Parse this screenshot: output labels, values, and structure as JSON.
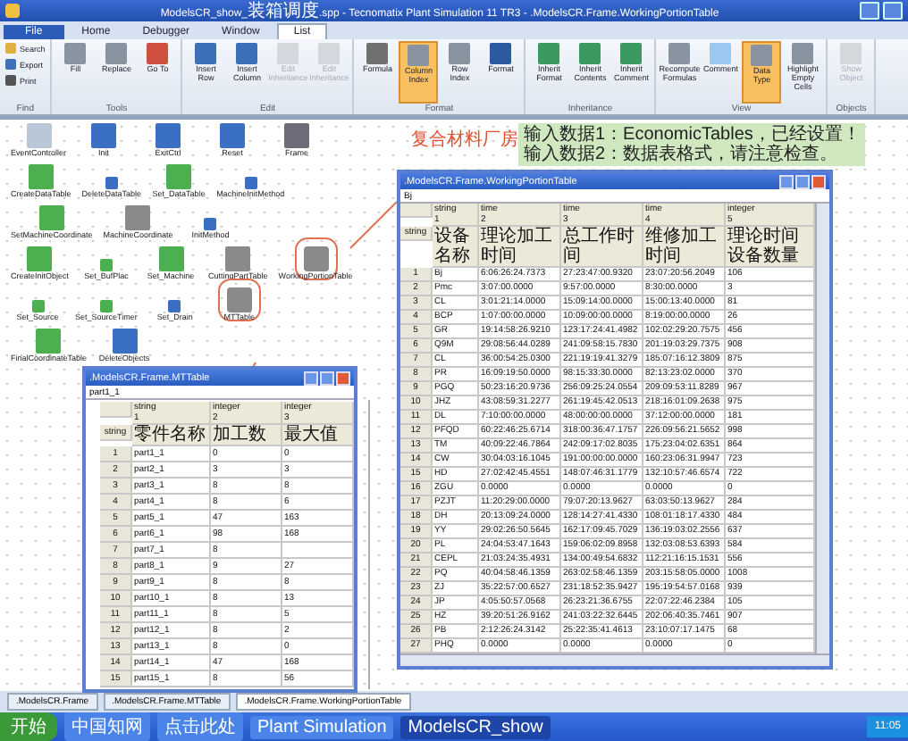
{
  "window": {
    "title_start": "ModelsCR_show_",
    "title_cjk": "装箱调度",
    "title_end": ".spp - Tecnomatix Plant Simulation 11 TR3 - .ModelsCR.Frame.WorkingPortionTable"
  },
  "menu_tabs": [
    {
      "label": "File",
      "selected": false,
      "kind": "file"
    },
    {
      "label": "Home",
      "selected": false,
      "kind": "tab"
    },
    {
      "label": "Debugger",
      "selected": false,
      "kind": "tab"
    },
    {
      "label": "Window",
      "selected": false,
      "kind": "tab"
    },
    {
      "label": "List",
      "selected": true,
      "kind": "tab"
    }
  ],
  "ribbon_groups": [
    {
      "label": "Find",
      "kind": "small",
      "buttons": [
        {
          "label": "Search",
          "selected": false,
          "kind": "find"
        },
        {
          "label": "Export",
          "selected": false,
          "kind": "save"
        },
        {
          "label": "Print",
          "selected": false,
          "kind": "print"
        }
      ]
    },
    {
      "label": "Tools",
      "kind": "large",
      "buttons": [
        {
          "label": "Fill",
          "selected": false,
          "kind": "grid"
        },
        {
          "label": "Replace",
          "selected": false,
          "kind": "grid"
        },
        {
          "label": "Go To",
          "selected": false,
          "kind": "goto"
        }
      ]
    },
    {
      "label": "Edit",
      "kind": "large",
      "buttons": [
        {
          "label": "Insert Row",
          "selected": false,
          "kind": "insert"
        },
        {
          "label": "Insert Column",
          "selected": false,
          "kind": "insert"
        },
        {
          "label": "Edit Inheritance",
          "selected": false,
          "kind": "disabled"
        },
        {
          "label": "Edit Inheritance",
          "selected": false,
          "kind": "disabled"
        }
      ]
    },
    {
      "label": "Format",
      "kind": "large",
      "buttons": [
        {
          "label": "Formula",
          "selected": false,
          "kind": "formula"
        },
        {
          "label": "Column Index",
          "selected": true,
          "kind": "grid"
        },
        {
          "label": "Row Index",
          "selected": false,
          "kind": "grid"
        },
        {
          "label": "Format",
          "selected": false,
          "kind": "format"
        }
      ]
    },
    {
      "label": "Inheritance",
      "kind": "large",
      "buttons": [
        {
          "label": "Inherit Format",
          "selected": false,
          "kind": "inherit"
        },
        {
          "label": "Inherit Contents",
          "selected": false,
          "kind": "inherit"
        },
        {
          "label": "Inherit Comment",
          "selected": false,
          "kind": "inherit"
        }
      ]
    },
    {
      "label": "View",
      "kind": "large",
      "buttons": [
        {
          "label": "Recompute Formulas",
          "selected": false,
          "kind": "grid"
        },
        {
          "label": "Comment",
          "selected": false,
          "kind": "comment"
        },
        {
          "label": "Data Type",
          "selected": true,
          "kind": "grid"
        },
        {
          "label": "Highlight Empty Cells",
          "selected": false,
          "kind": "grid"
        }
      ]
    },
    {
      "label": "Objects",
      "kind": "large",
      "buttons": [
        {
          "label": "Show Object",
          "selected": false,
          "kind": "disabled"
        }
      ]
    }
  ],
  "canvas_rows": [
    [
      {
        "label": "EventController",
        "kind": "event",
        "circled": false
      },
      {
        "label": "Init",
        "kind": "method_blue",
        "circled": false
      },
      {
        "label": "ExitCtrl",
        "kind": "method_blue",
        "circled": false
      },
      {
        "label": "Reset",
        "kind": "method_blue",
        "circled": false
      },
      {
        "label": "Frame",
        "kind": "frame",
        "circled": false
      }
    ],
    [
      {
        "label": "CreateDataTable",
        "kind": "method_green",
        "circled": false
      },
      {
        "label": "DeleteDataTable",
        "kind": "small_blue",
        "circled": false
      },
      {
        "label": "Set_DataTable",
        "kind": "method_green",
        "circled": false
      },
      {
        "label": "MachineInitMethod",
        "kind": "small_blue",
        "circled": false
      }
    ],
    [
      {
        "label": "SetMachineCoordinate",
        "kind": "method_green",
        "circled": false
      },
      {
        "label": "MachineCoordinate",
        "kind": "table",
        "circled": false
      },
      {
        "label": "InitMethod",
        "kind": "small_blue",
        "circled": false
      }
    ],
    [
      {
        "label": "CreateInitObject",
        "kind": "method_green",
        "circled": false
      },
      {
        "label": "Set_BufPlac",
        "kind": "small_green",
        "circled": false
      },
      {
        "label": "Set_Machine",
        "kind": "method_green",
        "circled": false
      },
      {
        "label": "CuttingPartTable",
        "kind": "table",
        "circled": false
      },
      {
        "label": "WorkingPortionTable",
        "kind": "table",
        "circled": true
      }
    ],
    [
      {
        "label": "Set_Source",
        "kind": "small_green",
        "circled": false
      },
      {
        "label": "Set_SourceTimer",
        "kind": "small_green",
        "circled": false
      },
      {
        "label": "Set_Drain",
        "kind": "small_blue",
        "circled": false
      },
      {
        "label": "MTTable",
        "kind": "table",
        "circled": true
      }
    ],
    [
      {
        "label": "FinalCoordinateTable",
        "kind": "method_green",
        "circled": false
      },
      {
        "label": "DeleteObjects",
        "kind": "method_blue",
        "circled": false
      }
    ]
  ],
  "annotation": "复合材料厂房",
  "comment_lines": [
    "输入数据1：EconomicTables，已经设置！",
    "输入数据2：数据表格式，请注意检查。"
  ],
  "main_table": {
    "title": ".ModelsCR.Frame.WorkingPortionTable",
    "cell_value": "Bj",
    "corner": "string",
    "types": [
      {
        "type": "string",
        "index": "1"
      },
      {
        "type": "time",
        "index": "2"
      },
      {
        "type": "time",
        "index": "3"
      },
      {
        "type": "time",
        "index": "4"
      },
      {
        "type": "integer",
        "index": "5"
      }
    ],
    "headers": [
      "设备名称",
      "理论加工时间",
      "总工作时间",
      "维修加工时间",
      "理论时间设备数量"
    ],
    "rows": [
      [
        "1",
        "Bj",
        "6:06:26:24.7373",
        "27:23:47:00.9320",
        "23:07:20:56.2049",
        "106"
      ],
      [
        "2",
        "Pmc",
        "3:07:00.0000",
        "9:57:00.0000",
        "8:30:00.0000",
        "3"
      ],
      [
        "3",
        "CL",
        "3:01:21:14.0000",
        "15:09:14:00.0000",
        "15:00:13:40.0000",
        "81"
      ],
      [
        "4",
        "BCP",
        "1:07:00:00.0000",
        "10:09:00:00.0000",
        "8:19:00:00.0000",
        "26"
      ],
      [
        "5",
        "GR",
        "19:14:58:26.9210",
        "123:17:24:41.4982",
        "102:02:29:20.7575",
        "456"
      ],
      [
        "6",
        "Q9M",
        "29:08:56:44.0289",
        "241:09:58:15.7830",
        "201:19:03:29.7375",
        "908"
      ],
      [
        "7",
        "CL",
        "36:00:54:25.0300",
        "221:19:19:41.3279",
        "185:07:16:12.3809",
        "875"
      ],
      [
        "8",
        "PR",
        "16:09:19:50.0000",
        "98:15:33:30.0000",
        "82:13:23:02.0000",
        "370"
      ],
      [
        "9",
        "PGQ",
        "50:23:16:20.9736",
        "256:09:25:24.0554",
        "209:09:53:11.8289",
        "967"
      ],
      [
        "10",
        "JHZ",
        "43:08:59:31.2277",
        "261:19:45:42.0513",
        "218:16:01:09.2638",
        "975"
      ],
      [
        "11",
        "DL",
        "7:10:00:00.0000",
        "48:00:00:00.0000",
        "37:12:00:00.0000",
        "181"
      ],
      [
        "12",
        "PFQD",
        "60:22:46:25.6714",
        "318:00:36:47.1757",
        "226:09:56:21.5652",
        "998"
      ],
      [
        "13",
        "TM",
        "40:09:22:46.7864",
        "242:09:17:02.8035",
        "175:23:04:02.6351",
        "864"
      ],
      [
        "14",
        "CW",
        "30:04:03:16.1045",
        "191:00:00:00.0000",
        "160:23:06:31.9947",
        "723"
      ],
      [
        "15",
        "HD",
        "27:02:42:45.4551",
        "148:07:46:31.1779",
        "132:10:57:46.6574",
        "722"
      ],
      [
        "16",
        "ZGU",
        "0.0000",
        "0.0000",
        "0.0000",
        "0"
      ],
      [
        "17",
        "PZJT",
        "11:20:29:00.0000",
        "79:07:20:13.9627",
        "63:03:50:13.9627",
        "284"
      ],
      [
        "18",
        "DH",
        "20:13:09:24.0000",
        "128:14:27:41.4330",
        "108:01:18:17.4330",
        "484"
      ],
      [
        "19",
        "YY",
        "29:02:26:50.5645",
        "162:17:09:45.7029",
        "136:19:03:02.2556",
        "637"
      ],
      [
        "20",
        "PL",
        "24:04:53:47.1643",
        "159:06:02:09.8958",
        "132:03:08:53.6393",
        "584"
      ],
      [
        "21",
        "CEPL",
        "21:03:24:35.4931",
        "134:00:49:54.6832",
        "112:21:16:15.1531",
        "556"
      ],
      [
        "22",
        "PQ",
        "40:04:58:46.1359",
        "263:02:58:46.1359",
        "203:15:58:05.0000",
        "1008"
      ],
      [
        "23",
        "ZJ",
        "35:22:57:00.6527",
        "231:18:52:35.9427",
        "195:19:54:57.0168",
        "939"
      ],
      [
        "24",
        "JP",
        "4:05:50:57.0568",
        "26:23:21:36.6755",
        "22:07:22:46.2384",
        "105"
      ],
      [
        "25",
        "HZ",
        "39:20:51:26.9162",
        "241:03:22:32.6445",
        "202:06:40:35.7461",
        "907"
      ],
      [
        "26",
        "PB",
        "2:12:26:24.3142",
        "25:22:35:41.4613",
        "23:10:07:17.1475",
        "68"
      ],
      [
        "27",
        "PHQ",
        "0.0000",
        "0.0000",
        "0.0000",
        "0"
      ]
    ]
  },
  "mt_table": {
    "title": ".ModelsCR.Frame.MTTable",
    "cell_value": "part1_1",
    "corner": "string",
    "types": [
      {
        "type": "string",
        "index": "1"
      },
      {
        "type": "integer",
        "index": "2"
      },
      {
        "type": "integer",
        "index": "3"
      }
    ],
    "headers": [
      "零件名称",
      "加工数",
      "最大值"
    ],
    "rows": [
      [
        "1",
        "part1_1",
        "0",
        "0"
      ],
      [
        "2",
        "part2_1",
        "3",
        "3"
      ],
      [
        "3",
        "part3_1",
        "8",
        "8"
      ],
      [
        "4",
        "part4_1",
        "8",
        "6"
      ],
      [
        "5",
        "part5_1",
        "47",
        "163"
      ],
      [
        "6",
        "part6_1",
        "98",
        "168"
      ],
      [
        "7",
        "part7_1",
        "8"
      ],
      [
        "8",
        "part8_1",
        "9",
        "27"
      ],
      [
        "9",
        "part9_1",
        "8",
        "8"
      ],
      [
        "10",
        "part10_1",
        "8",
        "13"
      ],
      [
        "11",
        "part11_1",
        "8",
        "5"
      ],
      [
        "12",
        "part12_1",
        "8",
        "2"
      ],
      [
        "13",
        "part13_1",
        "8",
        "0"
      ],
      [
        "14",
        "part14_1",
        "47",
        "168"
      ],
      [
        "15",
        "part15_1",
        "8",
        "56"
      ]
    ]
  },
  "doc_tabs": [
    {
      "label": ".ModelsCR.Frame",
      "selected": false
    },
    {
      "label": ".ModelsCR.Frame.MTTable",
      "selected": false
    },
    {
      "label": ".ModelsCR.Frame.WorkingPortionTable",
      "selected": true
    }
  ],
  "taskbar": {
    "start": "开始",
    "items": [
      {
        "label": "中国知网",
        "selected": false
      },
      {
        "label": "点击此处",
        "selected": false
      },
      {
        "label": "Plant Simulation",
        "selected": false
      },
      {
        "label": "ModelsCR_show",
        "selected": true
      }
    ],
    "clock": "11:05"
  }
}
